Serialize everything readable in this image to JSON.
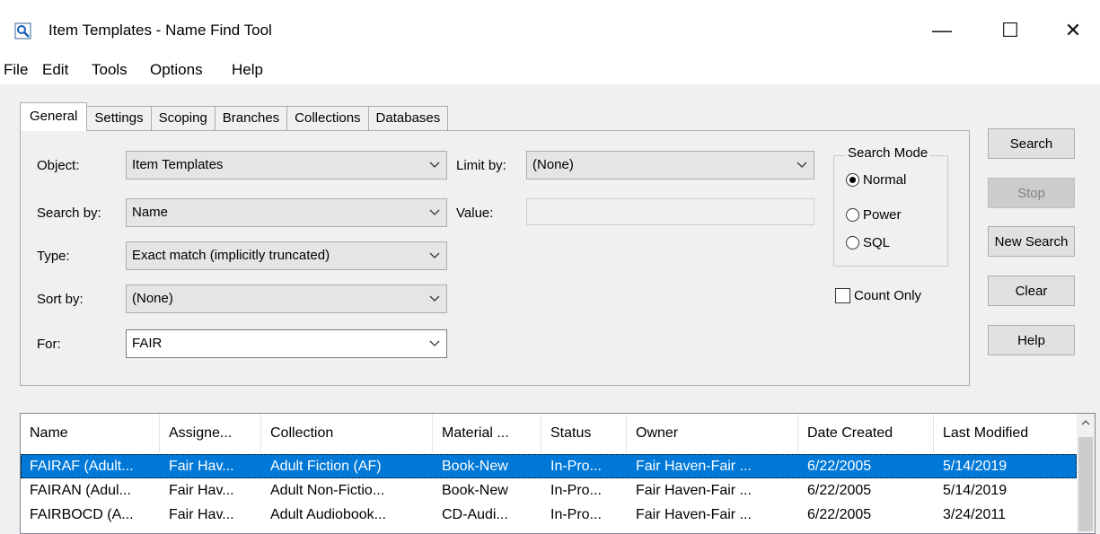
{
  "window": {
    "title": "Item Templates - Name Find Tool",
    "minimize_icon": "minimize-icon",
    "maximize_icon": "maximize-icon",
    "close_icon": "close-icon",
    "min_glyph": "—",
    "max_glyph": "☐",
    "close_glyph": "✕"
  },
  "menu": [
    "File",
    "Edit",
    "Tools",
    "Options",
    "Help"
  ],
  "tabs": [
    "General",
    "Settings",
    "Scoping",
    "Branches",
    "Collections",
    "Databases"
  ],
  "active_tab": "General",
  "form": {
    "object_label": "Object:",
    "object_value": "Item Templates",
    "search_by_label": "Search by:",
    "search_by_value": "Name",
    "type_label": "Type:",
    "type_value": "Exact match (implicitly truncated)",
    "sort_by_label": "Sort by:",
    "sort_by_value": "(None)",
    "for_label": "For:",
    "for_value": "FAIR",
    "limit_by_label": "Limit by:",
    "limit_by_value": "(None)",
    "value_label": "Value:",
    "value_value": ""
  },
  "search_mode": {
    "title": "Search Mode",
    "options": [
      "Normal",
      "Power",
      "SQL"
    ],
    "selected": "Normal"
  },
  "count_only": {
    "label": "Count Only",
    "checked": false
  },
  "buttons": {
    "search": "Search",
    "stop": "Stop",
    "new_search": "New Search",
    "clear": "Clear",
    "help": "Help"
  },
  "results": {
    "columns": [
      "Name",
      "Assigne...",
      "Collection",
      "Material ...",
      "Status",
      "Owner",
      "Date Created",
      "Last Modified"
    ],
    "rows": [
      [
        "FAIRAF (Adult...",
        "Fair Hav...",
        "Adult Fiction (AF)",
        "Book-New",
        "In-Pro...",
        "Fair Haven-Fair ...",
        "6/22/2005",
        "5/14/2019"
      ],
      [
        "FAIRAN (Adul...",
        "Fair Hav...",
        "Adult Non-Fictio...",
        "Book-New",
        "In-Pro...",
        "Fair Haven-Fair ...",
        "6/22/2005",
        "5/14/2019"
      ],
      [
        "FAIRBOCD (A...",
        "Fair Hav...",
        "Adult Audiobook...",
        "CD-Audi...",
        "In-Pro...",
        "Fair Haven-Fair ...",
        "6/22/2005",
        "3/24/2011"
      ]
    ],
    "selected_row": 0
  },
  "colors": {
    "selection": "#0078d7",
    "window_bg": "#f0f0f0",
    "button_bg": "#e1e1e1"
  }
}
